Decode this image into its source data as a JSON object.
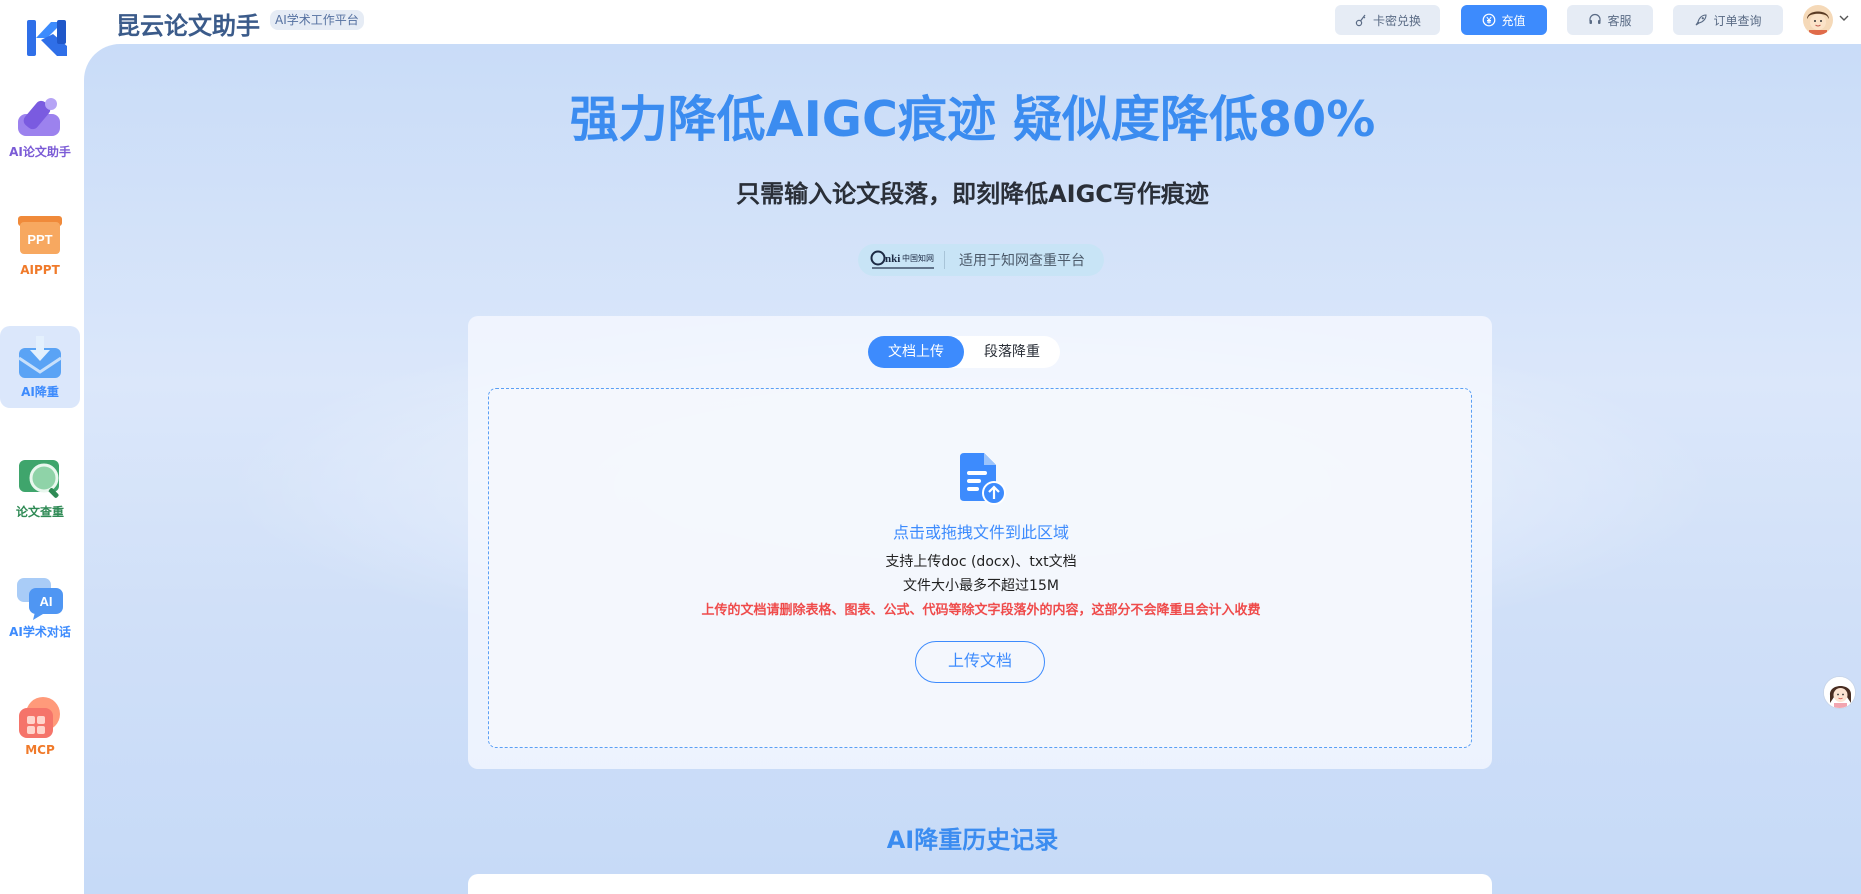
{
  "header": {
    "brand_title": "昆云论文助手",
    "brand_badge": "AI学术工作平台",
    "buttons": [
      {
        "label": "卡密兑换",
        "icon": "key-icon"
      },
      {
        "label": "充值",
        "icon": "yuan-coin-icon"
      },
      {
        "label": "客服",
        "icon": "headset-icon"
      },
      {
        "label": "订单查询",
        "icon": "rocket-icon"
      }
    ]
  },
  "sidebar": {
    "items": [
      {
        "label": "AI论文助手",
        "color": "#7b5bd6",
        "active": false
      },
      {
        "label": "AIPPT",
        "color": "#f07a2a",
        "active": false
      },
      {
        "label": "AI降重",
        "color": "#3d8bfd",
        "active": true
      },
      {
        "label": "论文查重",
        "color": "#2f8a55",
        "active": false
      },
      {
        "label": "AI学术对话",
        "color": "#3d8bfd",
        "active": false
      },
      {
        "label": "MCP",
        "color": "#f07a2a",
        "active": false
      }
    ]
  },
  "hero": {
    "title": "强力降低AIGC痕迹 疑似度降低80%",
    "subtitle": "只需输入论文段落，即刻降低AIGC写作痕迹",
    "platform_logo_text": "CNKI中国知网",
    "platform_text": "适用于知网查重平台"
  },
  "upload_card": {
    "tabs": [
      {
        "label": "文档上传",
        "active": true
      },
      {
        "label": "段落降重",
        "active": false
      }
    ],
    "dropzone_title": "点击或拖拽文件到此区域",
    "support_text": "支持上传doc (docx)、txt文档",
    "size_text": "文件大小最多不超过15M",
    "warning_text": "上传的文档请删除表格、图表、公式、代码等除文字段落外的内容，这部分不会降重且会计入收费",
    "upload_button": "上传文档"
  },
  "history": {
    "title": "AI降重历史记录"
  },
  "colors": {
    "accent": "#3d8bfd",
    "warning": "#ef4b4b",
    "brand": "#3b5b8a"
  }
}
